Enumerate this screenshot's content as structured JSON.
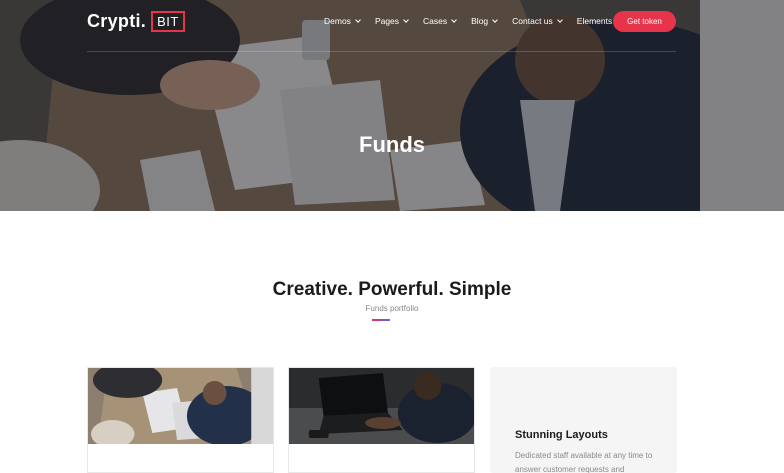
{
  "brand": {
    "name": "Crypti.",
    "badge": "BIT",
    "accent": "#e8344a"
  },
  "nav": {
    "items": [
      {
        "label": "Demos"
      },
      {
        "label": "Pages"
      },
      {
        "label": "Cases"
      },
      {
        "label": "Blog"
      },
      {
        "label": "Contact us"
      },
      {
        "label": "Elements"
      }
    ],
    "cta": "Get token"
  },
  "hero": {
    "title": "Funds"
  },
  "section": {
    "title": "Creative. Powerful. Simple",
    "subtitle": "Funds portfolio"
  },
  "cards": [
    {
      "image": "meeting-photo"
    },
    {
      "image": "laptop-photo"
    },
    {
      "title": "Stunning Layouts",
      "text": "Dedicated staff available at any time to answer customer requests and"
    }
  ]
}
